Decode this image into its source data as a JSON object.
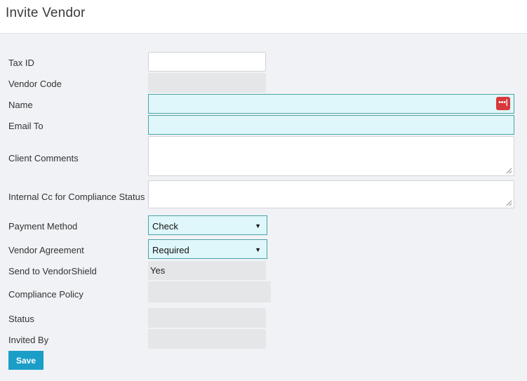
{
  "header": {
    "title": "Invite Vendor"
  },
  "form": {
    "tax_id": {
      "label": "Tax ID",
      "value": ""
    },
    "vendor_code": {
      "label": "Vendor Code",
      "value": ""
    },
    "name": {
      "label": "Name",
      "value": "",
      "icon": "password-manager-icon"
    },
    "email_to": {
      "label": "Email To",
      "value": ""
    },
    "client_comments": {
      "label": "Client Comments",
      "value": ""
    },
    "internal_cc": {
      "label": "Internal Cc for Compliance Status",
      "value": ""
    },
    "payment_method": {
      "label": "Payment Method",
      "value": "Check"
    },
    "vendor_agreement": {
      "label": "Vendor Agreement",
      "value": "Required"
    },
    "send_to_vendorshield": {
      "label": "Send to VendorShield",
      "value": "Yes"
    },
    "compliance_policy": {
      "label": "Compliance Policy",
      "value": ""
    },
    "status": {
      "label": "Status",
      "value": ""
    },
    "invited_by": {
      "label": "Invited By",
      "value": ""
    }
  },
  "actions": {
    "save_label": "Save"
  },
  "colors": {
    "accent": "#1a9ec8",
    "highlight_bg": "#dff7fa",
    "highlight_border": "#4aa3a8",
    "readonly_bg": "#e4e6e8",
    "password_icon": "#d8393a"
  }
}
